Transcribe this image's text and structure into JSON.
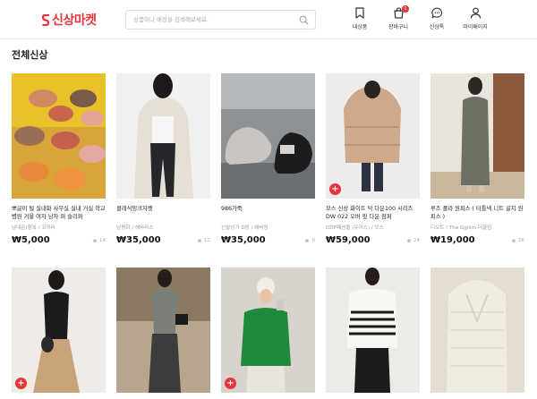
{
  "header": {
    "logo_text": "신상마켓",
    "logo_color": "#e8333b",
    "search_placeholder": "상품이나 매장을 검색해보세요.",
    "nav": [
      {
        "label": "내상품",
        "icon": "bookmark-icon"
      },
      {
        "label": "장바구니",
        "icon": "cart-icon",
        "badge": "1"
      },
      {
        "label": "신상톡",
        "icon": "chat-icon"
      },
      {
        "label": "마이페이지",
        "icon": "user-icon"
      }
    ]
  },
  "section": {
    "title": "전체신상"
  },
  "products": [
    {
      "title": "뽀글이 털 실내화 사무실 실내 거실 학교 병원 겨울 여자 남자 퍼 슬리퍼",
      "seller": "남대문(행복 / 코끼리",
      "price": "₩5,000",
      "likes": "14",
      "plus": false
    },
    {
      "title": "클래식밍크자켓",
      "seller": "남평화 / 해바라스",
      "price": "₩35,000",
      "likes": "12",
      "plus": false
    },
    {
      "title": "986가죽",
      "seller": "신발상가 D동 / 해바링",
      "price": "₩35,000",
      "likes": "0",
      "plus": false
    },
    {
      "title": "모스 신상 화이트 덕 다운100 시리즈 DW 022 오버 핏 다운 점퍼",
      "seller": "DDP패션몰 (유어스) / 모스",
      "price": "₩59,000",
      "likes": "24",
      "plus": true
    },
    {
      "title": "루즈 폴라 원피스 ( 터틀넥 니트 골지 원피스 )",
      "seller": "디오트 / The Ggilim 더끌림",
      "price": "₩19,000",
      "likes": "26",
      "plus": false
    },
    {
      "title": "",
      "seller": "",
      "price": "",
      "likes": "",
      "plus": true
    },
    {
      "title": "",
      "seller": "",
      "price": "",
      "likes": "",
      "plus": false
    },
    {
      "title": "",
      "seller": "",
      "price": "",
      "likes": "",
      "plus": true
    },
    {
      "title": "",
      "seller": "",
      "price": "",
      "likes": "",
      "plus": false
    },
    {
      "title": "",
      "seller": "",
      "price": "",
      "likes": "",
      "plus": false
    }
  ],
  "colors": {
    "accent": "#e8333b",
    "muted": "#999999"
  }
}
